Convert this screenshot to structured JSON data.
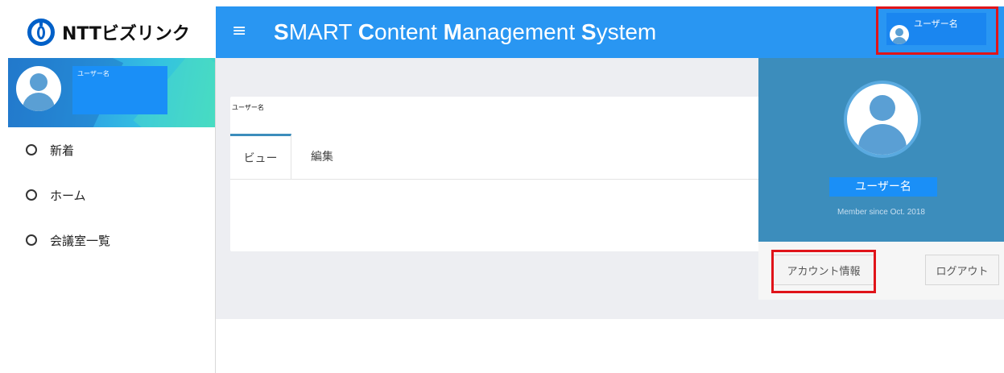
{
  "logo": {
    "text": "NTTビズリンク"
  },
  "header": {
    "menu_icon": "≡",
    "title_parts": [
      {
        "bold": "S",
        "rest": "MART "
      },
      {
        "bold": "C",
        "rest": "ontent "
      },
      {
        "bold": "M",
        "rest": "anagement "
      },
      {
        "bold": "S",
        "rest": "ystem"
      }
    ],
    "user_name": "ユーザー名"
  },
  "sidebar": {
    "profile_name": "ユーザー名",
    "items": [
      {
        "label": "新着"
      },
      {
        "label": "ホーム"
      },
      {
        "label": "会議室一覧"
      }
    ]
  },
  "main": {
    "card_title": "ユーザー名",
    "tabs": [
      {
        "label": "ビュー"
      },
      {
        "label": "編集"
      }
    ]
  },
  "dropdown": {
    "user_name": "ユーザー名",
    "member_since": "Member since Oct. 2018",
    "account_button": "アカウント情報",
    "logout_button": "ログアウト"
  },
  "colors": {
    "topbar": "#2996f2",
    "dropdown_header": "#3c8dbc",
    "highlight": "#e0141a",
    "content_bg": "#edeef2"
  }
}
